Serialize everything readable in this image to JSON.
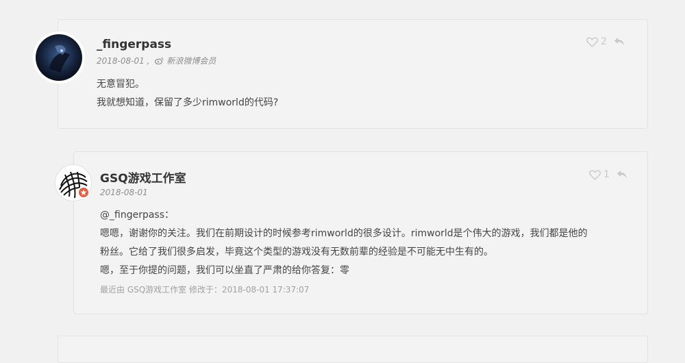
{
  "comments": [
    {
      "author": "_fingerpass",
      "date": "2018-08-01 ,",
      "source": "新浪微博会员",
      "likes": "2",
      "lines": [
        "无意冒犯。",
        "我就想知道，保留了多少rimworld的代码?"
      ]
    },
    {
      "author": "GSQ游戏工作室",
      "date": "2018-08-01",
      "likes": "1",
      "mention": "@_fingerpass：",
      "lines": [
        "嗯嗯，谢谢你的关注。我们在前期设计的时候参考rimworld的很多设计。rimworld是个伟大的游戏，我们都是他的",
        "粉丝。它给了我们很多启发，毕竟这个类型的游戏没有无数前辈的经验是不可能无中生有的。",
        "嗯，至于你提的问题，我们可以坐直了严肃的给你答复：零"
      ],
      "edited": "最近由 GSQ游戏工作室 修改于：2018-08-01 17:37:07"
    }
  ],
  "colors": {
    "background": "#f1f1f1",
    "card": "#f3f3f3",
    "badge": "#e85a3d",
    "icon": "#c9c9c9"
  },
  "icons": [
    "heart-icon",
    "reply-icon",
    "weibo-icon",
    "star-badge-icon"
  ]
}
